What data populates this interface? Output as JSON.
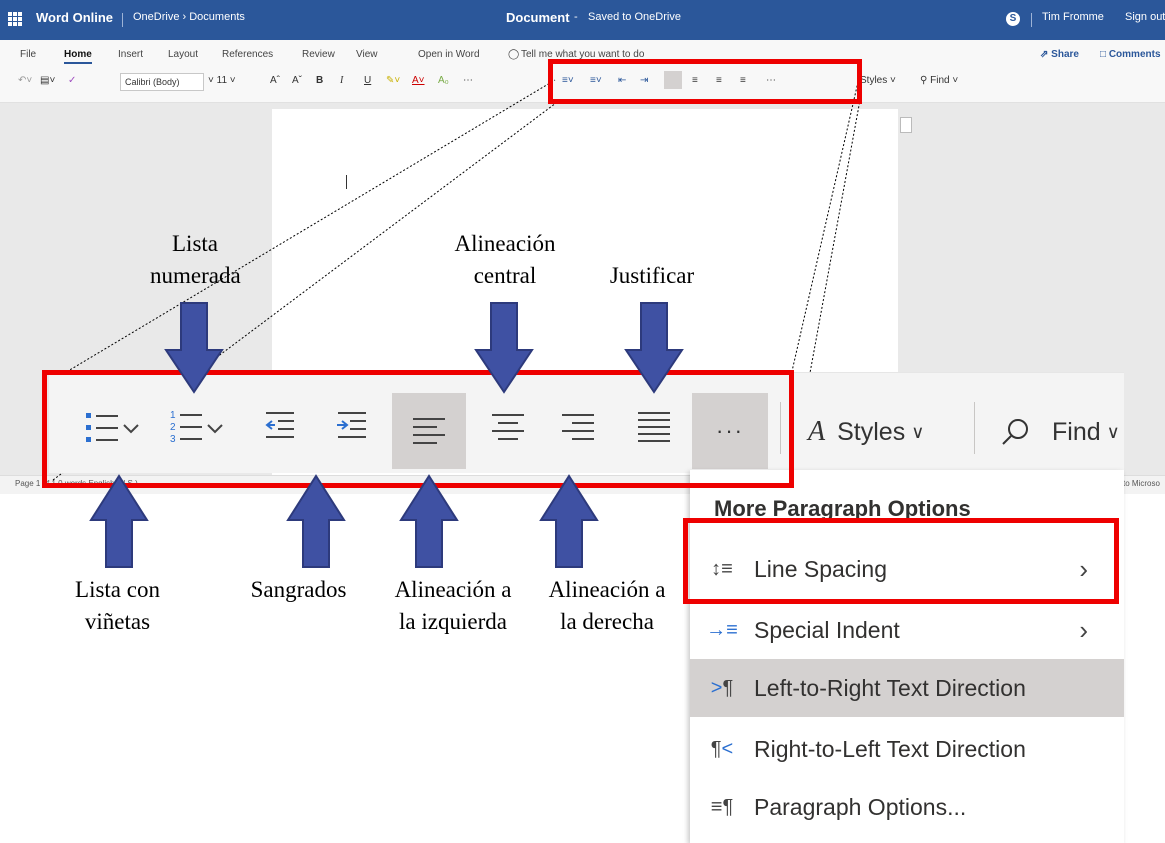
{
  "titlebar": {
    "app": "Word Online",
    "breadcrumb": "OneDrive › Documents",
    "doc_title": "Document",
    "sep": "-",
    "saved": "Saved to OneDrive",
    "user": "Tim Fromme",
    "signout": "Sign out"
  },
  "ribbon": {
    "tabs": [
      "File",
      "Home",
      "Insert",
      "Layout",
      "References",
      "Review",
      "View",
      "Open in Word"
    ],
    "tell_me": "Tell me what you want to do",
    "share": "Share",
    "comments": "Comments",
    "font_name": "Calibri (Body)",
    "font_size": "11",
    "bold": "B",
    "italic": "I",
    "underline": "U",
    "styles": "Styles",
    "find": "Find"
  },
  "statusbar": {
    "left": "Page 1 of 1    0 words    English (U.S.)",
    "right": "to Microso"
  },
  "bigbar": {
    "more": "···",
    "styles": "Styles",
    "find": "Find"
  },
  "menu": {
    "header": "More Paragraph Options",
    "items": [
      {
        "label": "Line Spacing",
        "has_submenu": true
      },
      {
        "label": "Special Indent",
        "has_submenu": true
      },
      {
        "label": "Left-to-Right Text Direction",
        "has_submenu": false
      },
      {
        "label": "Right-to-Left Text Direction",
        "has_submenu": false
      },
      {
        "label": "Paragraph Options...",
        "has_submenu": false
      }
    ]
  },
  "callouts": {
    "numbered_1": "Lista",
    "numbered_2": "numerada",
    "center_1": "Alineación",
    "center_2": "central",
    "justify": "Justificar",
    "bullets_1": "Lista con",
    "bullets_2": "viñetas",
    "indents": "Sangrados",
    "left_1": "Alineación a",
    "left_2": "la izquierda",
    "right_1": "Alineación a",
    "right_2": "la derecha"
  },
  "colors": {
    "titlebar": "#2b579a",
    "highlight_red": "#ee0000",
    "arrow_fill": "#3f51a3",
    "arrow_stroke": "#2d3a7c"
  }
}
